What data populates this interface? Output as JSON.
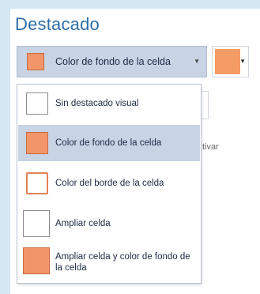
{
  "section": {
    "title": "Destacado"
  },
  "highlight_dropdown": {
    "selected_label": "Color de fondo de la celda",
    "arrow_icon": "chevron-down-icon"
  },
  "color_picker": {
    "color": "#f59b66",
    "arrow_icon": "chevron-down-icon"
  },
  "background_text": "tivar",
  "menu": {
    "items": [
      {
        "label": "Sin destacado visual",
        "icon": "no-highlight-icon",
        "selected": false
      },
      {
        "label": "Color de fondo de la celda",
        "icon": "cell-fill-icon",
        "selected": true
      },
      {
        "label": "Color del borde de la celda",
        "icon": "cell-border-icon",
        "selected": false
      },
      {
        "label": "Ampliar celda",
        "icon": "enlarge-cell-icon",
        "selected": false
      },
      {
        "label": "Ampliar celda y color de fondo de la celda",
        "icon": "enlarge-fill-icon",
        "selected": false
      }
    ]
  },
  "colors": {
    "accent_fill": "#f2966a",
    "selection": "#c8d3e4",
    "title": "#2f6fa8"
  }
}
